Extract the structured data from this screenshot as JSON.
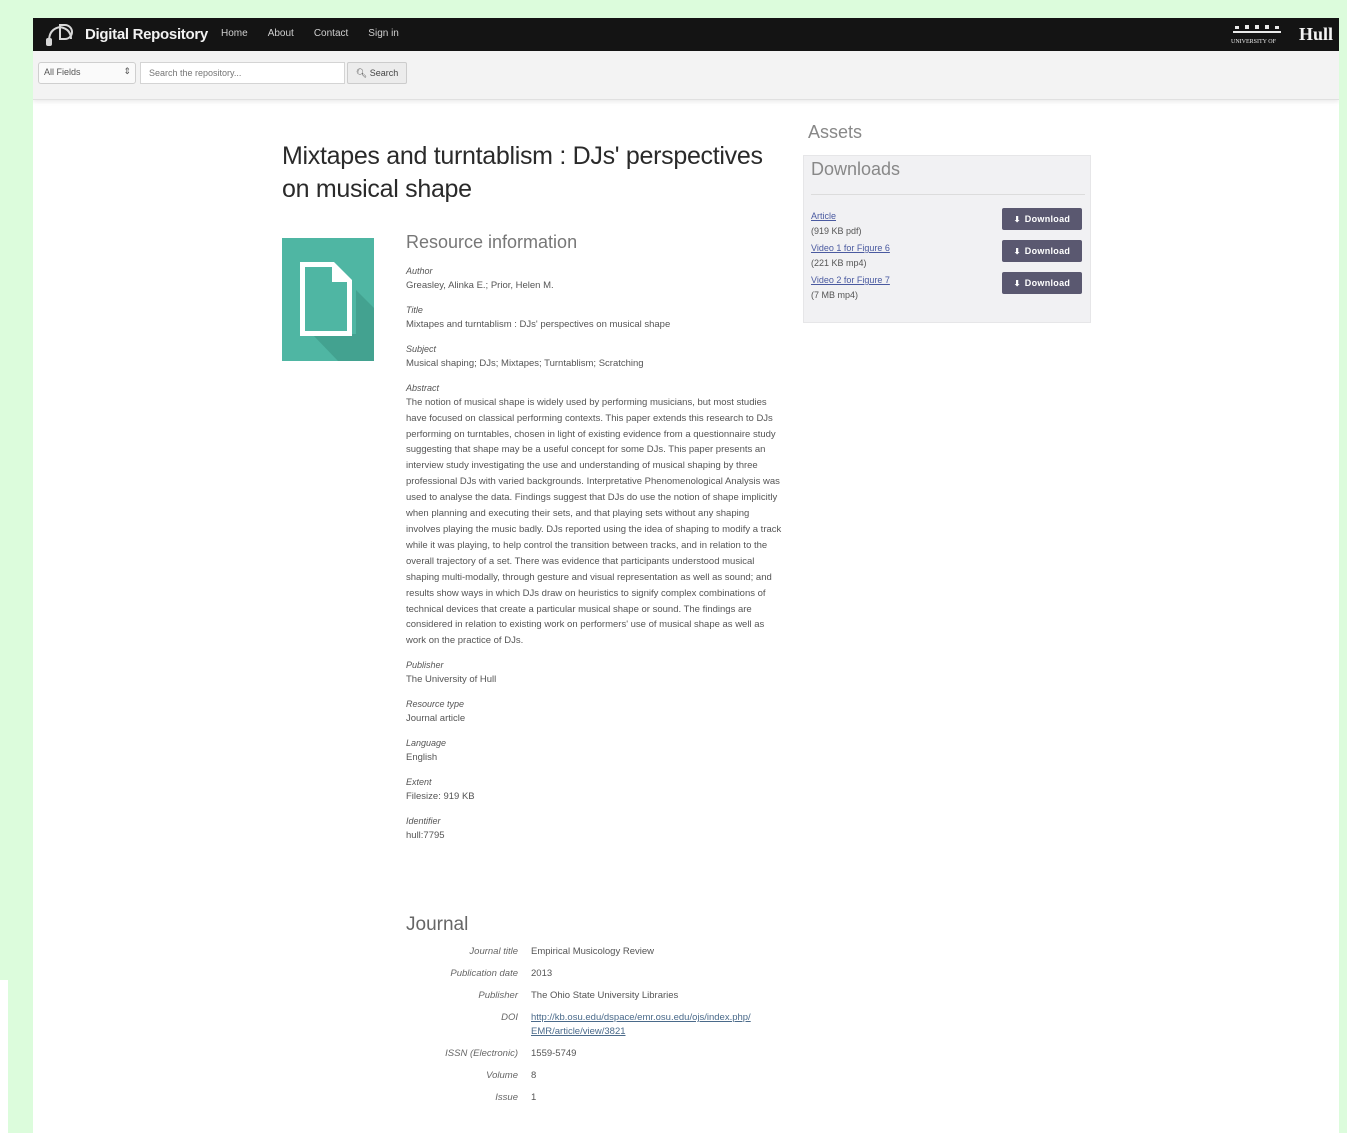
{
  "brand": {
    "name": "Digital Repository",
    "logo_icon": "dj-headphones-logo"
  },
  "nav": {
    "items": [
      "Home",
      "About",
      "Contact",
      "Sign in"
    ]
  },
  "university": {
    "name": "Hull",
    "full_name": "University of Hull"
  },
  "search": {
    "field_select": "All Fields",
    "placeholder": "Search the repository...",
    "button_label": "Search"
  },
  "record": {
    "title": "Mixtapes and turntablism : DJs' perspectives on musical shape",
    "resource_heading": "Resource information",
    "fields": [
      {
        "label": "Author",
        "value": "Greasley, Alinka E.; Prior, Helen M."
      },
      {
        "label": "Title",
        "value": "Mixtapes and turntablism : DJs' perspectives on musical shape"
      },
      {
        "label": "Subject",
        "value": "Musical shaping; DJs; Mixtapes; Turntablism; Scratching"
      },
      {
        "label": "Abstract",
        "value": "The notion of musical shape is widely used by performing musicians, but most studies have focused on classical performing contexts. This paper extends this research to DJs performing on turntables, chosen in light of existing evidence from a questionnaire study suggesting that shape may be a useful concept for some DJs. This paper presents an interview study investigating the use and understanding of musical shaping by three professional DJs with varied backgrounds. Interpretative Phenomenological Analysis was used to analyse the data. Findings suggest that DJs do use the notion of shape implicitly when planning and executing their sets, and that playing sets without any shaping involves playing the music badly. DJs reported using the idea of shaping to modify a track while it was playing, to help control the transition between tracks, and in relation to the overall trajectory of a set. There was evidence that participants understood musical shaping multi-modally, through gesture and visual representation as well as sound; and results show ways in which DJs draw on heuristics to signify complex combinations of technical devices that create a particular musical shape or sound. The findings are considered in relation to existing work on performers' use of musical shape as well as work on the practice of DJs."
      },
      {
        "label": "Publisher",
        "value": "The University of Hull"
      },
      {
        "label": "Resource type",
        "value": "Journal article"
      },
      {
        "label": "Language",
        "value": "English"
      },
      {
        "label": "Extent",
        "value": "Filesize: 919 KB"
      },
      {
        "label": "Identifier",
        "value": "hull:7795"
      }
    ]
  },
  "journal": {
    "heading": "Journal",
    "rows": [
      {
        "label": "Journal title",
        "value": "Empirical Musicology Review"
      },
      {
        "label": "Publication date",
        "value": "2013"
      },
      {
        "label": "Publisher",
        "value": "The Ohio State University Libraries"
      },
      {
        "label": "DOI",
        "value": "http://kb.osu.edu/dspace/emr.osu.edu/ojs/index.php/EMR/article/view/3821"
      },
      {
        "label": "ISSN (Electronic)",
        "value": "1559-5749"
      },
      {
        "label": "Volume",
        "value": "8"
      },
      {
        "label": "Issue",
        "value": "1"
      }
    ]
  },
  "assets": {
    "heading": "Assets",
    "downloads_heading": "Downloads",
    "items": [
      {
        "name": "Article",
        "size": "(919 KB pdf)",
        "button": "Download"
      },
      {
        "name": "Video 1 for Figure 6",
        "size": "(221 KB mp4)",
        "button": "Download"
      },
      {
        "name": "Video 2 for Figure 7",
        "size": "(7 MB mp4)",
        "button": "Download"
      }
    ]
  },
  "colors": {
    "topbar": "#141414",
    "doc_tile": "#4fb6a3",
    "download_button": "#5a5870",
    "page_bg": "#dcfcdc"
  }
}
